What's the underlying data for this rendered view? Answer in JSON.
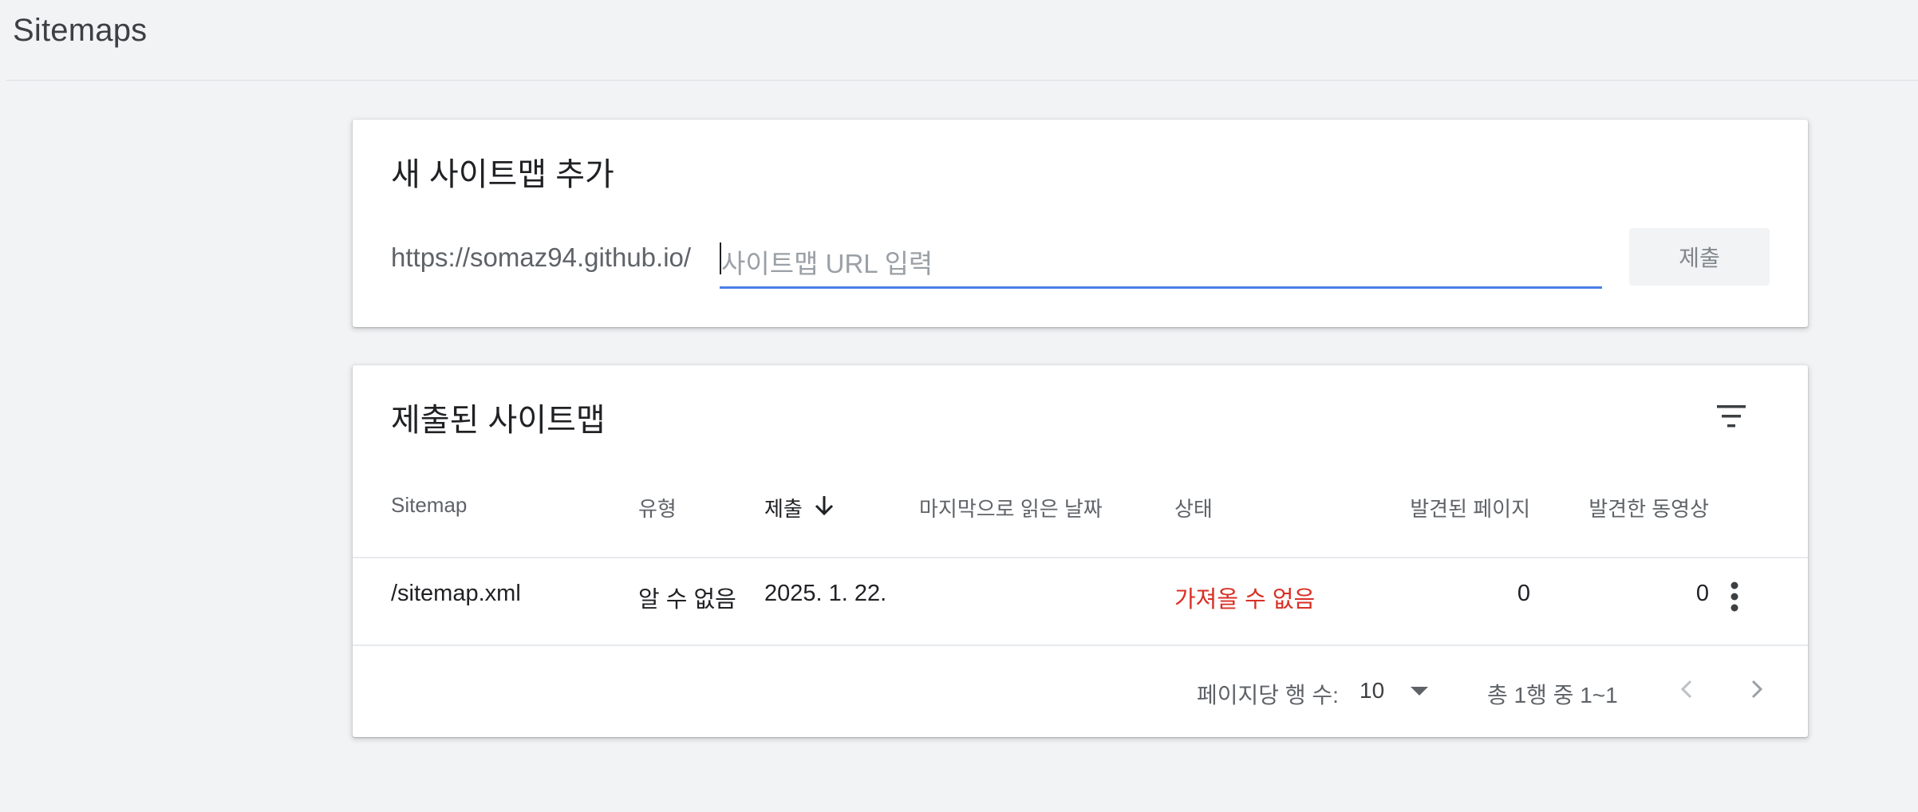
{
  "header": {
    "title": "Sitemaps"
  },
  "add_card": {
    "title": "새 사이트맵 추가",
    "url_prefix": "https://somaz94.github.io/",
    "input_placeholder": "사이트맵 URL 입력",
    "input_value": "",
    "submit_label": "제출"
  },
  "list_card": {
    "title": "제출된 사이트맵",
    "columns": {
      "sitemap": "Sitemap",
      "type": "유형",
      "submitted": "제출",
      "last_read": "마지막으로 읽은 날짜",
      "status": "상태",
      "pages_found": "발견된 페이지",
      "videos_found": "발견한 동영상"
    },
    "rows": [
      {
        "sitemap": "/sitemap.xml",
        "type": "알 수 없음",
        "submitted": "2025. 1. 22.",
        "last_read": "",
        "status": "가져올 수 없음",
        "pages_found": "0",
        "videos_found": "0"
      }
    ],
    "pagination": {
      "rows_per_page_label": "페이지당 행 수:",
      "rows_per_page_value": "10",
      "range_text": "총 1행 중 1~1"
    }
  },
  "colors": {
    "accent": "#4a7fe8",
    "error": "#d93025",
    "background": "#f1f3f4"
  }
}
